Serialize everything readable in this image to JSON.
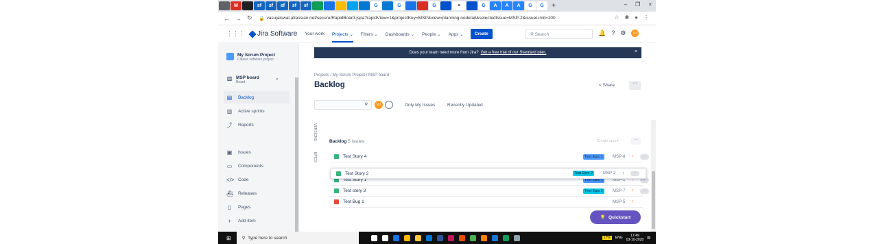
{
  "browser": {
    "tabs": [
      "",
      "M",
      "",
      "sf",
      "sf",
      "sf",
      "sf",
      "sf",
      "",
      "",
      "",
      "",
      "",
      "G",
      "",
      "G",
      "",
      "",
      "G",
      "",
      "",
      "G",
      "A",
      "A",
      "A",
      "G",
      "G"
    ],
    "active_tab_close": "×",
    "new_tab": "+",
    "url": "vasujaiswal.atlassian.net/secure/RapidBoard.jspa?rapidView=1&projectKey=MSP&view=planning.nodetail&selectedIssue=MSP-2&issueLimit=100",
    "window_controls": [
      "–",
      "❐",
      "×"
    ]
  },
  "topnav": {
    "logo": "Jira Software",
    "items": [
      "Your work",
      "Projects",
      "Filters",
      "Dashboards",
      "People",
      "Apps"
    ],
    "active_item": "Projects",
    "create": "Create",
    "search_placeholder": "Search",
    "avatar_initials": "VJ"
  },
  "sidebar": {
    "project_name": "My Scrum Project",
    "project_sub": "Classic software project",
    "board_name": "MSP board",
    "board_sub": "Board",
    "items": [
      {
        "label": "Backlog",
        "icon": "backlog-icon",
        "selected": true
      },
      {
        "label": "Active sprints",
        "icon": "sprint-icon",
        "selected": false
      },
      {
        "label": "Reports",
        "icon": "reports-icon",
        "selected": false
      },
      {
        "label": "Issues",
        "icon": "issues-icon",
        "selected": false
      },
      {
        "label": "Components",
        "icon": "components-icon",
        "selected": false
      },
      {
        "label": "Code",
        "icon": "code-icon",
        "selected": false
      },
      {
        "label": "Releases",
        "icon": "releases-icon",
        "selected": false
      },
      {
        "label": "Pages",
        "icon": "pages-icon",
        "selected": false
      },
      {
        "label": "Add item",
        "icon": "add-icon",
        "selected": false
      }
    ]
  },
  "banner": {
    "text": "Does your team need more from Jira?",
    "link": "Get a free trial of our Standard plan."
  },
  "page": {
    "breadcrumb": "Projects  /  My Scrum Project  /  MSP board",
    "title": "Backlog",
    "share": "Share",
    "filters": [
      "Only My Issues",
      "Recently Updated"
    ],
    "side_labels": [
      "VERSIONS",
      "EPICS"
    ]
  },
  "backlog": {
    "title": "Backlog",
    "count": "5 issues",
    "create_sprint": "Create sprint",
    "issues": [
      {
        "summary": "Test Story 4",
        "type": "story",
        "epic": "Test Epic 1",
        "epic_color": "#4c9aff",
        "key": "MSP-8"
      },
      {
        "summary": "Test Story 2",
        "type": "story",
        "epic": "Test Epic 2",
        "epic_color": "#00c7e6",
        "key": "MSP-2"
      },
      {
        "summary": "Test Story 1",
        "type": "story",
        "epic": "Test Epic 1",
        "epic_color": "#4c9aff",
        "key": "MSP-1"
      },
      {
        "summary": "Test story 3",
        "type": "story",
        "epic": "Test Epic 2",
        "epic_color": "#00c7e6",
        "key": "MSP-7"
      },
      {
        "summary": "Test Bug 1",
        "type": "bug",
        "epic": "",
        "epic_color": "",
        "key": "MSP-5"
      }
    ],
    "estimate": "-"
  },
  "quickstart": "Quickstart",
  "taskbar": {
    "search": "Type here to search",
    "battery": "17%",
    "lang": "ENG",
    "time": "17:49",
    "date": "03-10-2020"
  }
}
